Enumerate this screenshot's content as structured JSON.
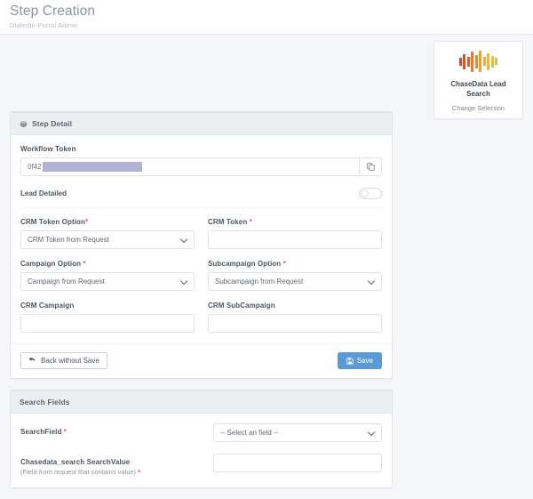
{
  "header": {
    "title": "Step Creation",
    "subtitle": "DialedIn Portal Admin"
  },
  "selection_card": {
    "logo_icon": "waveform-icon",
    "name": "ChaseData Lead Search",
    "change_label": "Change Selection",
    "logo_colors": [
      "#d9452a",
      "#e05a26",
      "#e8742a",
      "#ed8a2b",
      "#efa02d",
      "#f0b331",
      "#e8b93a",
      "#dfbd47"
    ]
  },
  "step_detail": {
    "panel_icon": "cube-icon",
    "panel_title": "Step Detail",
    "workflow_token": {
      "label": "Workflow Token",
      "value": "0f42",
      "copy_icon": "copy-icon"
    },
    "lead_detailed": {
      "label": "Lead Detailed",
      "checked": false
    },
    "crm_token_option": {
      "label": "CRM Token Option",
      "required": "*",
      "value": "CRM Token from Request",
      "options": [
        "CRM Token from Request"
      ]
    },
    "crm_token": {
      "label": "CRM Token",
      "required": "*",
      "value": "",
      "placeholder": ""
    },
    "campaign_option": {
      "label": "Campaign Option",
      "required": "*",
      "value": "Campaign from Request",
      "options": [
        "Campaign from Request"
      ]
    },
    "subcampaign_option": {
      "label": "Subcampaign Option",
      "required": "*",
      "value": "Subcampaign from Request",
      "options": [
        "Subcampaign from Request"
      ]
    },
    "crm_campaign": {
      "label": "CRM Campaign",
      "value": "",
      "placeholder": ""
    },
    "crm_subcampaign": {
      "label": "CRM SubCampaign",
      "value": "",
      "placeholder": ""
    },
    "back_button": {
      "label": "Back without Save",
      "icon": "undo-arrow-icon"
    },
    "save_button": {
      "label": "Save",
      "icon": "save-disk-icon",
      "color": "#5b9bd5"
    }
  },
  "search_fields": {
    "panel_title": "Search Fields",
    "search_field": {
      "label": "SearchField",
      "required": "*",
      "value": "-- Select an field --",
      "options": [
        "-- Select an field --"
      ]
    },
    "search_value": {
      "label": "Chasedata_search SearchValue",
      "sub_label": "(Field from request that contains value)",
      "required": "*",
      "value": "",
      "placeholder": ""
    }
  }
}
